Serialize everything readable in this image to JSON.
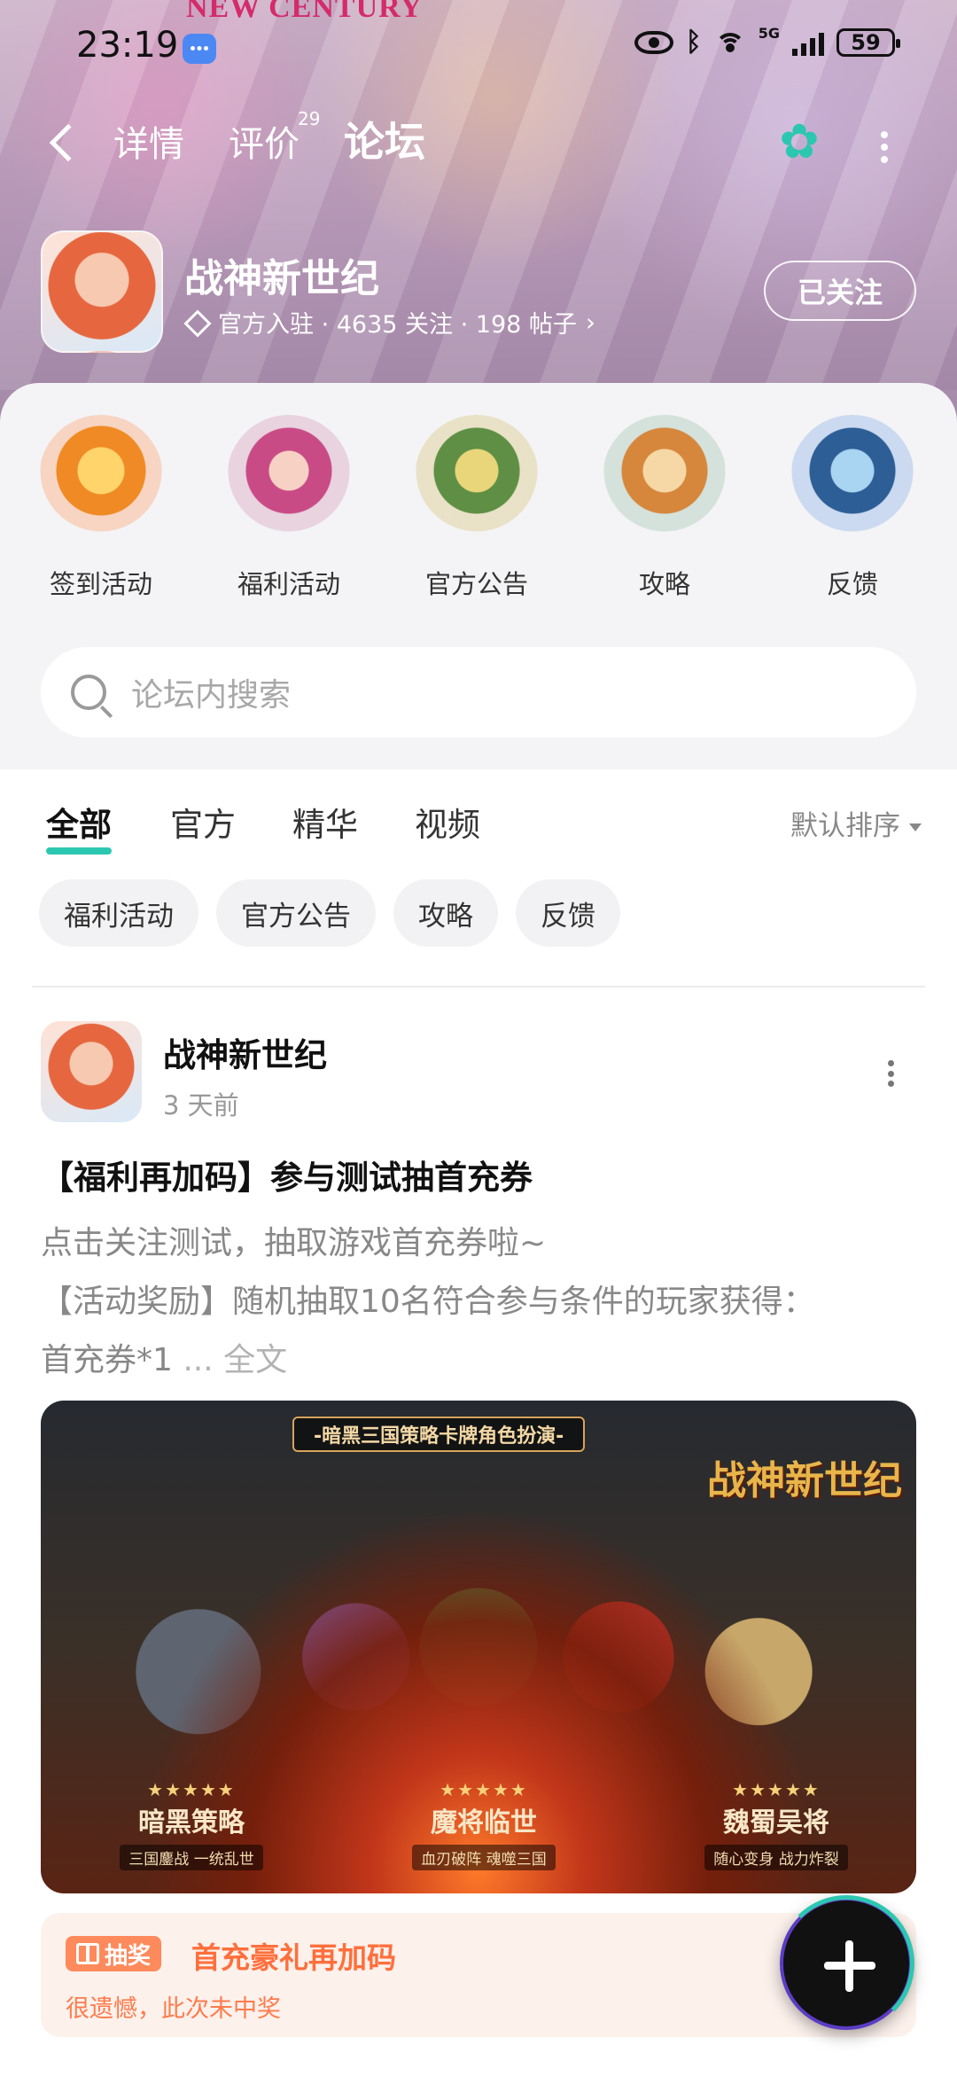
{
  "status_bar": {
    "time": "23:19",
    "network": "5G",
    "battery": "59"
  },
  "banner": {
    "title": "NEW CENTURY"
  },
  "nav": {
    "tabs": [
      {
        "label": "详情"
      },
      {
        "label": "评价",
        "count": "29"
      },
      {
        "label": "论坛",
        "active": true
      }
    ]
  },
  "game": {
    "name": "战神新世纪",
    "meta": "官方入驻 · 4635 关注 · 198 帖子",
    "follow_label": "已关注"
  },
  "categories": [
    {
      "label": "签到活动",
      "icon": "sign-in-event-icon"
    },
    {
      "label": "福利活动",
      "icon": "welfare-event-icon"
    },
    {
      "label": "官方公告",
      "icon": "announcement-icon"
    },
    {
      "label": "攻略",
      "icon": "guide-icon"
    },
    {
      "label": "反馈",
      "icon": "feedback-icon"
    }
  ],
  "search": {
    "placeholder": "论坛内搜索"
  },
  "filter_tabs": [
    {
      "label": "全部",
      "active": true
    },
    {
      "label": "官方"
    },
    {
      "label": "精华"
    },
    {
      "label": "视频"
    }
  ],
  "sort_label": "默认排序",
  "chips": [
    "福利活动",
    "官方公告",
    "攻略",
    "反馈"
  ],
  "post": {
    "author": "战神新世纪",
    "time": "3 天前",
    "title": "【福利再加码】参与测试抽首充券",
    "body_line1": "点击关注测试，抽取游戏首充券啦~",
    "body_line2": "【活动奖励】随机抽取10名符合参与条件的玩家获得：",
    "body_line3": "首充券*1",
    "more_ellipsis": " ... ",
    "more_label": "全文",
    "image": {
      "banner": "-暗黑三国策略卡牌角色扮演-",
      "logo": "战神新世纪",
      "badges": [
        {
          "stars": "★★★★★",
          "name": "暗黑策略",
          "sub": "三国鏖战 一统乱世"
        },
        {
          "stars": "★★★★★",
          "name": "魔将临世",
          "sub": "血刃破阵 魂噬三国"
        },
        {
          "stars": "★★★★★",
          "name": "魏蜀吴将",
          "sub": "随心变身 战力炸裂"
        }
      ]
    }
  },
  "lottery": {
    "tag": "抽奖",
    "title": "首充豪礼再加码",
    "result": "很遗憾，此次未中奖"
  },
  "colors": {
    "accent": "#2cc7b0",
    "lottery": "#ff6f3c"
  }
}
